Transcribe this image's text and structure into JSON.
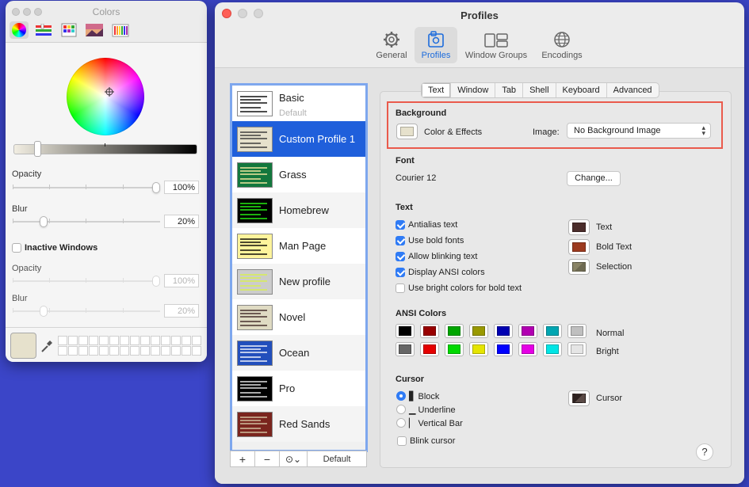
{
  "colors_panel": {
    "title": "Colors",
    "tools": [
      "color-wheel-icon",
      "color-sliders-icon",
      "color-palettes-icon",
      "image-palettes-icon",
      "pencils-icon"
    ],
    "opacity_label": "Opacity",
    "opacity_value": "100%",
    "blur_label": "Blur",
    "blur_value": "20%",
    "inactive_label": "Inactive Windows",
    "inactive_opacity_label": "Opacity",
    "inactive_opacity_value": "100%",
    "inactive_blur_label": "Blur",
    "inactive_blur_value": "20%",
    "current_color": "#e6e1cc"
  },
  "profiles_window": {
    "title": "Profiles",
    "toolbar": [
      {
        "label": "General",
        "icon": "gear-icon"
      },
      {
        "label": "Profiles",
        "icon": "profiles-icon",
        "active": true
      },
      {
        "label": "Window Groups",
        "icon": "window-groups-icon"
      },
      {
        "label": "Encodings",
        "icon": "globe-icon"
      }
    ],
    "profiles": [
      {
        "name": "Basic",
        "sub": "Default",
        "bg": "#ffffff",
        "fg": "#000000"
      },
      {
        "name": "Custom Profile 1",
        "bg": "#e6e1cc",
        "fg": "#333333",
        "selected": true
      },
      {
        "name": "Grass",
        "bg": "#13773d",
        "fg": "#fff0a5"
      },
      {
        "name": "Homebrew",
        "bg": "#000000",
        "fg": "#28fe14"
      },
      {
        "name": "Man Page",
        "bg": "#fef49c",
        "fg": "#000000"
      },
      {
        "name": "New profile",
        "bg": "#cccccc",
        "fg": "#d8f14a"
      },
      {
        "name": "Novel",
        "bg": "#dfdbc3",
        "fg": "#3b2322"
      },
      {
        "name": "Ocean",
        "bg": "#224fbc",
        "fg": "#ffffff"
      },
      {
        "name": "Pro",
        "bg": "#000000",
        "fg": "#f2f2f2"
      },
      {
        "name": "Red Sands",
        "bg": "#7a251e",
        "fg": "#d7c9a7"
      }
    ],
    "list_buttons": {
      "add": "+",
      "remove": "−",
      "more": "⊙⌄",
      "default": "Default"
    },
    "tabs": [
      "Text",
      "Window",
      "Tab",
      "Shell",
      "Keyboard",
      "Advanced"
    ],
    "active_tab": "Text",
    "background": {
      "heading": "Background",
      "color_effects_label": "Color & Effects",
      "image_label": "Image:",
      "image_value": "No Background Image",
      "swatch": "#e6e1cc"
    },
    "font": {
      "heading": "Font",
      "value": "Courier 12",
      "change_button": "Change..."
    },
    "text": {
      "heading": "Text",
      "options": [
        {
          "label": "Antialias text",
          "checked": true
        },
        {
          "label": "Use bold fonts",
          "checked": true
        },
        {
          "label": "Allow blinking text",
          "checked": true
        },
        {
          "label": "Display ANSI colors",
          "checked": true
        },
        {
          "label": "Use bright colors for bold text",
          "checked": false
        }
      ],
      "colors": [
        {
          "label": "Text",
          "color": "#4b2d2b"
        },
        {
          "label": "Bold Text",
          "color": "#9c3a1f"
        },
        {
          "label": "Selection",
          "color": "#8a8466"
        }
      ]
    },
    "ansi": {
      "heading": "ANSI Colors",
      "normal_label": "Normal",
      "bright_label": "Bright",
      "normal": [
        "#000000",
        "#990000",
        "#00a600",
        "#999900",
        "#0000b2",
        "#b200b2",
        "#00a6b2",
        "#bfbfbf"
      ],
      "bright": [
        "#666666",
        "#e50000",
        "#00d900",
        "#e5e500",
        "#0000ff",
        "#e500e5",
        "#00e5e5",
        "#e5e5e5"
      ]
    },
    "cursor": {
      "heading": "Cursor",
      "options": [
        {
          "glyph": "▋",
          "label": "Block",
          "selected": true
        },
        {
          "glyph": "▁",
          "label": "Underline",
          "selected": false
        },
        {
          "glyph": "▏",
          "label": "Vertical Bar",
          "selected": false
        }
      ],
      "blink_label": "Blink cursor",
      "color_label": "Cursor",
      "color": "#3a2a28"
    },
    "help": "?"
  }
}
